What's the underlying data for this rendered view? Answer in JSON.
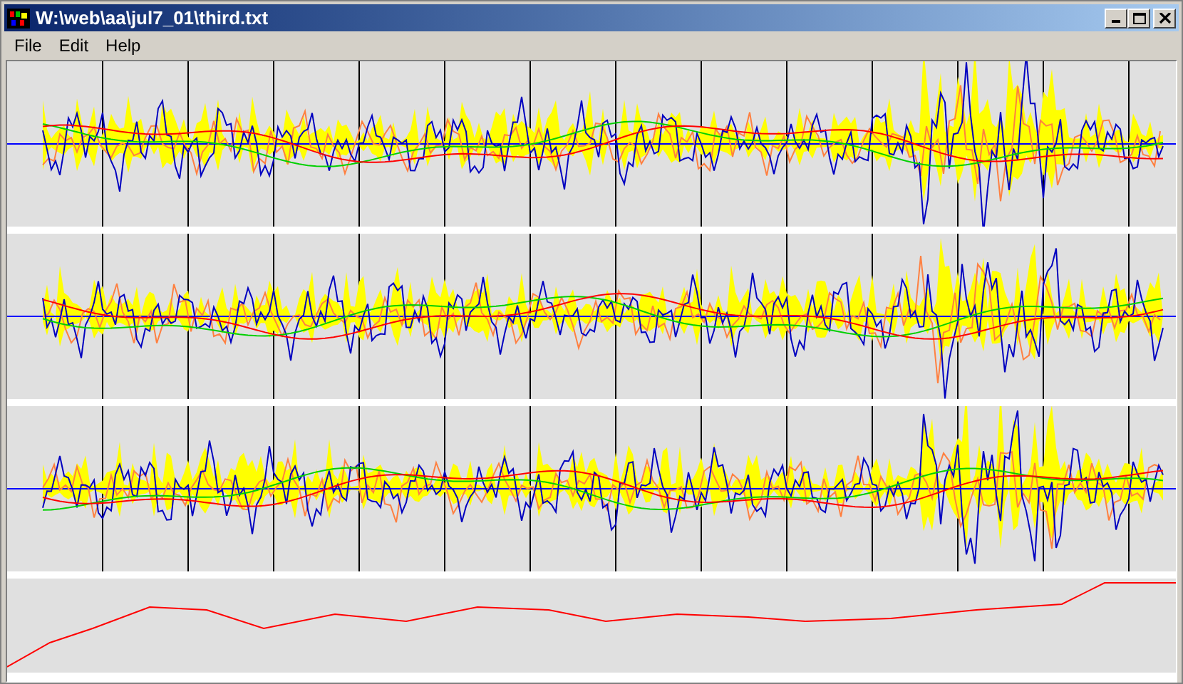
{
  "window": {
    "title": "W:\\web\\aa\\jul7_01\\third.txt"
  },
  "menu": [
    "File",
    "Edit",
    "Help"
  ],
  "plots": [
    {
      "kind": "multi"
    },
    {
      "kind": "multi"
    },
    {
      "kind": "multi"
    },
    {
      "kind": "single"
    }
  ]
}
